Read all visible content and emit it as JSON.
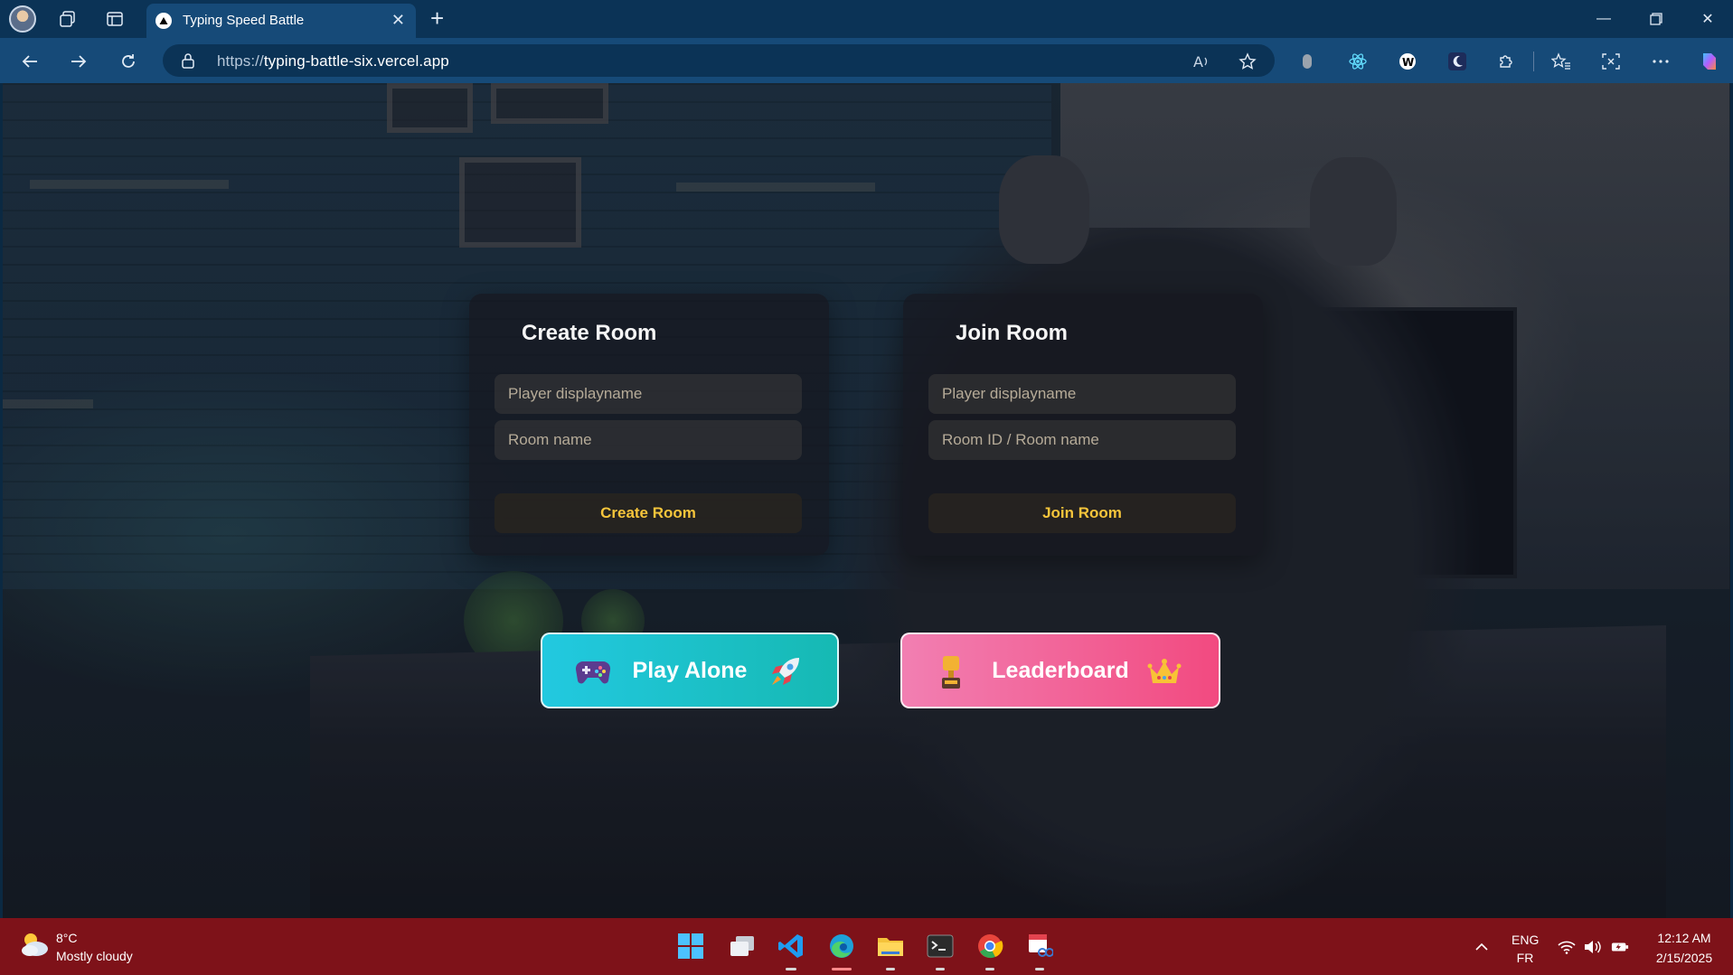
{
  "browser": {
    "tab": {
      "title": "Typing Speed Battle"
    },
    "address": {
      "url_prefix": "https://",
      "url_host": "typing-battle-six.vercel.app"
    }
  },
  "page": {
    "create_room": {
      "title": "Create Room",
      "display_name_placeholder": "Player displayname",
      "room_name_placeholder": "Room name",
      "button_label": "Create Room"
    },
    "join_room": {
      "title": "Join Room",
      "display_name_placeholder": "Player displayname",
      "room_id_placeholder": "Room ID / Room name",
      "button_label": "Join Room"
    },
    "play_alone": {
      "label": "Play Alone",
      "left_icon": "gamepad-icon",
      "right_icon": "rocket-icon"
    },
    "leaderboard": {
      "label": "Leaderboard",
      "left_icon": "trophy-icon",
      "right_icon": "crown-icon"
    },
    "colors": {
      "accent_yellow": "#f6c53b",
      "play_alone": "#1fc3d2",
      "leaderboard": "#f2628f"
    }
  },
  "taskbar": {
    "weather": {
      "temp": "8°C",
      "desc": "Mostly cloudy"
    },
    "language": {
      "primary": "ENG",
      "secondary": "FR"
    },
    "clock": {
      "time": "12:12 AM",
      "date": "2/15/2025"
    }
  }
}
